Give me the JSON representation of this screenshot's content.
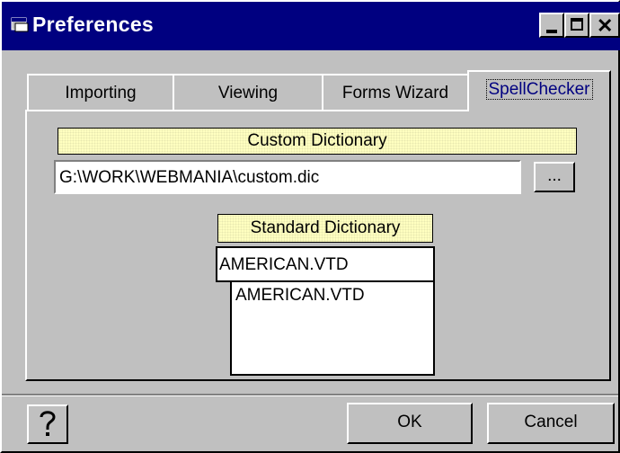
{
  "window": {
    "title": "Preferences"
  },
  "tabs": [
    {
      "label": "Importing"
    },
    {
      "label": "Viewing"
    },
    {
      "label": "Forms Wizard"
    },
    {
      "label": "SpellChecker"
    }
  ],
  "custom_dictionary": {
    "label": "Custom Dictionary",
    "path": "G:\\WORK\\WEBMANIA\\custom.dic",
    "browse_label": "..."
  },
  "standard_dictionary": {
    "label": "Standard Dictionary",
    "selected": "AMERICAN.VTD",
    "options": [
      "AMERICAN.VTD"
    ]
  },
  "buttons": {
    "ok": "OK",
    "cancel": "Cancel",
    "help": "?"
  }
}
